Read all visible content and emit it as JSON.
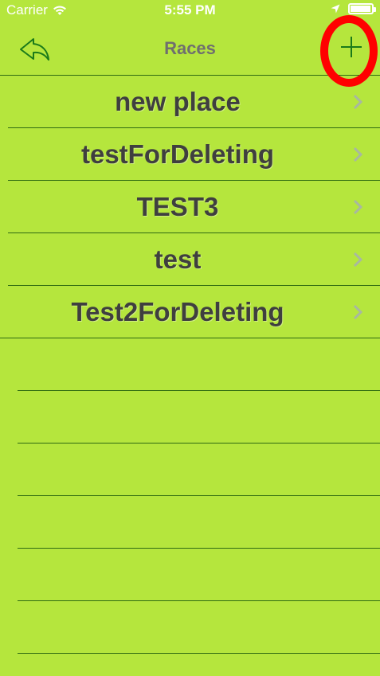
{
  "status_bar": {
    "carrier": "Carrier",
    "time": "5:55 PM",
    "icons": [
      "wifi-icon",
      "location-arrow-icon",
      "battery-icon"
    ]
  },
  "nav": {
    "title": "Races",
    "back_icon": "reply-arrow-icon",
    "add_icon": "plus-icon"
  },
  "races": [
    {
      "label": "new place"
    },
    {
      "label": "testForDeleting"
    },
    {
      "label": "TEST3"
    },
    {
      "label": "test"
    },
    {
      "label": "Test2ForDeleting"
    }
  ],
  "colors": {
    "background": "#b5e63d",
    "tint": "#1a7a1a",
    "title": "#6f6f6f",
    "row_text": "#3f3f3f",
    "separator": "#2f6b12",
    "highlight": "#ff0000"
  }
}
